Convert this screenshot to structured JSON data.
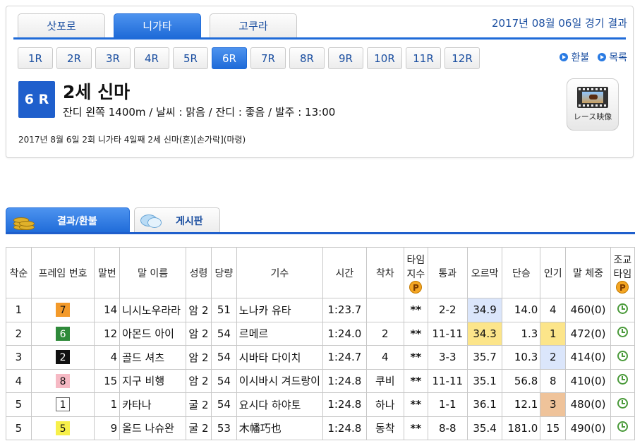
{
  "header": {
    "venues": [
      {
        "label": "삿포로",
        "active": false
      },
      {
        "label": "니가타",
        "active": true
      },
      {
        "label": "고쿠라",
        "active": false
      }
    ],
    "date_title": "2017년 08월 06일 경기 결과"
  },
  "races": [
    "1R",
    "2R",
    "3R",
    "4R",
    "5R",
    "6R",
    "7R",
    "8R",
    "9R",
    "10R",
    "11R",
    "12R"
  ],
  "active_race": "6R",
  "links": {
    "refund": "환불",
    "list": "목록"
  },
  "race": {
    "badge": "6 R",
    "name": "2세 신마",
    "conditions": "잔디 왼쪽 1400m / 날씨 : 맑음 / 잔디 : 좋음 / 발주 : 13:00",
    "note": "2017년 8월 6일 2회 니가타 4일째 2세 신마(혼)[손가락](마령)",
    "video_label": "レース映像"
  },
  "sections": {
    "results": "결과/환불",
    "board": "게시판"
  },
  "columns": {
    "rank": "착순",
    "frame": "프레임 번호",
    "horse_no": "말번",
    "horse": "말 이름",
    "sex_age": "성령",
    "weight": "당량",
    "jockey": "기수",
    "time": "시간",
    "margin": "착차",
    "time_index_1": "타임",
    "time_index_2": "지수",
    "passing": "통과",
    "last3f": "오르막",
    "odds": "단승",
    "popularity": "인기",
    "body_weight": "말 체중",
    "training_1": "조교",
    "training_2": "타임"
  },
  "icons": {
    "p_icon": "P",
    "coins": "coins-icon",
    "bubble": "speech-bubble-icon",
    "clock": "clock-icon"
  },
  "frame_colors": {
    "1": {
      "bg": "#ffffff",
      "fg": "#111111",
      "border": "#666666"
    },
    "2": {
      "bg": "#111111",
      "fg": "#ffffff",
      "border": "#111111"
    },
    "5": {
      "bg": "#f7f04a",
      "fg": "#111111",
      "border": "#f7f04a"
    },
    "6": {
      "bg": "#2f8a3a",
      "fg": "#ffffff",
      "border": "#2f8a3a"
    },
    "7": {
      "bg": "#f39a2a",
      "fg": "#111111",
      "border": "#f39a2a"
    },
    "8": {
      "bg": "#f6b9c4",
      "fg": "#111111",
      "border": "#f6b9c4"
    }
  },
  "rows": [
    {
      "rank": "1",
      "frame": "7",
      "horse_no": "14",
      "horse": "니시노우라라",
      "sex_age": "암 2",
      "weight": "51",
      "jockey": "노나카 유타",
      "time": "1:23.7",
      "margin": "",
      "index": "**",
      "passing": "2-2",
      "last3f": "34.9",
      "last3f_hl": "blue",
      "odds": "14.0",
      "pop": "4",
      "pop_hl": "",
      "body": "460(0)"
    },
    {
      "rank": "2",
      "frame": "6",
      "horse_no": "12",
      "horse": "아몬드 아이",
      "sex_age": "암 2",
      "weight": "54",
      "jockey": "르메르",
      "time": "1:24.0",
      "margin": "2",
      "index": "**",
      "passing": "11-11",
      "last3f": "34.3",
      "last3f_hl": "yellow",
      "odds": "1.3",
      "pop": "1",
      "pop_hl": "yellow",
      "body": "472(0)"
    },
    {
      "rank": "3",
      "frame": "2",
      "horse_no": "4",
      "horse": "골드 셔츠",
      "sex_age": "암 2",
      "weight": "54",
      "jockey": "시바타 다이치",
      "time": "1:24.7",
      "margin": "4",
      "index": "**",
      "passing": "3-3",
      "last3f": "35.7",
      "last3f_hl": "",
      "odds": "10.3",
      "pop": "2",
      "pop_hl": "blue",
      "body": "414(0)"
    },
    {
      "rank": "4",
      "frame": "8",
      "horse_no": "15",
      "horse": "지구 비행",
      "sex_age": "암 2",
      "weight": "54",
      "jockey": "이시바시 겨드랑이",
      "time": "1:24.8",
      "margin": "쿠비",
      "index": "**",
      "passing": "11-11",
      "last3f": "35.1",
      "last3f_hl": "",
      "odds": "56.8",
      "pop": "8",
      "pop_hl": "",
      "body": "410(0)"
    },
    {
      "rank": "5",
      "frame": "1",
      "horse_no": "1",
      "horse": "카타나",
      "sex_age": "굴 2",
      "weight": "54",
      "jockey": "요시다 하야토",
      "time": "1:24.8",
      "margin": "하나",
      "index": "**",
      "passing": "1-1",
      "last3f": "36.1",
      "last3f_hl": "",
      "odds": "12.1",
      "pop": "3",
      "pop_hl": "tan",
      "body": "480(0)"
    },
    {
      "rank": "5",
      "frame": "5",
      "horse_no": "9",
      "horse": "올드 나슈완",
      "sex_age": "굴 2",
      "weight": "53",
      "jockey": "木幡巧也",
      "time": "1:24.8",
      "margin": "동착",
      "index": "**",
      "passing": "8-8",
      "last3f": "35.4",
      "last3f_hl": "",
      "odds": "181.0",
      "pop": "15",
      "pop_hl": "",
      "body": "490(0)"
    }
  ]
}
